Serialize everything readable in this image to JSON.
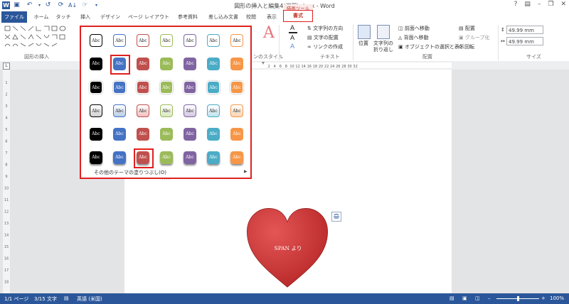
{
  "window": {
    "title": "図形の挿入と編集4(演習).docx - Word"
  },
  "qat": {
    "items": [
      "word-logo-icon",
      "save-icon",
      "undo-icon",
      "redo-icon",
      "refresh-icon",
      "sort-icon",
      "touch-icon",
      "customize-icon"
    ]
  },
  "tabs": {
    "file": "ファイル",
    "home": "ホーム",
    "touch": "タッチ",
    "insert": "挿入",
    "design": "デザイン",
    "layout": "ページ レイアウト",
    "references": "参考資料",
    "mailings": "差し込み文書",
    "review": "校閲",
    "view": "表示",
    "context_label": "描画ツール",
    "format": "書式"
  },
  "ribbon": {
    "insert_shapes_label": "図形の挿入",
    "shape_styles_label": "ンのスタイル",
    "text_label": "テキスト",
    "arrange_label": "配置",
    "size_label": "サイズ",
    "text_direction": "文字列の方向",
    "text_align": "文字の配置",
    "create_link": "リンクの作成",
    "position": "位置",
    "wrap_text_1": "文字列の",
    "wrap_text_2": "折り返し",
    "bring_forward": "前面へ移動",
    "send_backward": "背面へ移動",
    "selection_pane": "オブジェクトの選択と表示",
    "align": "配置",
    "group": "グループ化",
    "rotate": "回転",
    "height": "49.99 mm",
    "width": "49.99 mm",
    "wordart_letter": "A"
  },
  "ruler": {
    "ticks": [
      "2",
      "4",
      "6",
      "8",
      "10",
      "12",
      "14",
      "16",
      "18",
      "20",
      "22",
      "24",
      "26",
      "28",
      "30",
      "32"
    ]
  },
  "vruler": {
    "ticks": [
      "1",
      "2",
      "3",
      "4",
      "5",
      "6",
      "7",
      "8",
      "9",
      "10",
      "11",
      "12",
      "13",
      "14",
      "15",
      "16",
      "17",
      "18"
    ]
  },
  "gallery": {
    "swatch_label": "Abc",
    "selected": [
      [
        1,
        1
      ],
      [
        5,
        2
      ]
    ],
    "theme_colors": [
      "#000000",
      "#4472c4",
      "#c0504d",
      "#9bbb59",
      "#8064a2",
      "#4bacc6",
      "#f79646"
    ],
    "light_colors": [
      "#cfcfcf",
      "#b8cce4",
      "#f2c0bf",
      "#d9e8bf",
      "#d1c6e0",
      "#bfe3ec",
      "#fcd5b4"
    ],
    "more_fills": "その他のテーマの塗りつぶし(O)"
  },
  "shape": {
    "text": "SPAN より",
    "fill": "#d23a3a"
  },
  "status": {
    "page": "1/1 ページ",
    "words": "3/15 文字",
    "language": "英語 (米国)",
    "zoom": "100%"
  }
}
